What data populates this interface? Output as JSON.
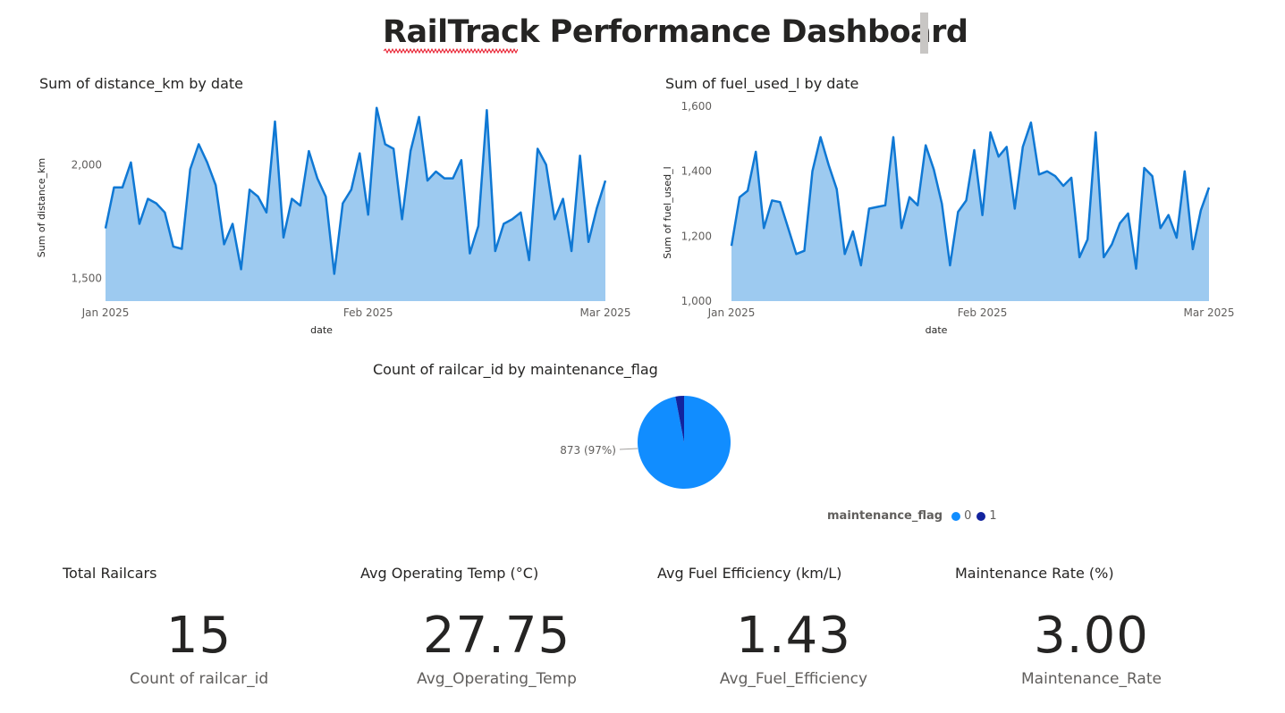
{
  "report": {
    "title": "RailTrack Performance Dashboard"
  },
  "colors": {
    "line": "#0f78d4",
    "area": "#9dcaf0",
    "pie_0": "#118dff",
    "pie_1": "#12239e"
  },
  "chart_data": [
    {
      "type": "area",
      "title": "Sum of distance_km by date",
      "xlabel": "date",
      "ylabel": "Sum of distance_km",
      "x_ticks": [
        "Jan 2025",
        "Feb 2025",
        "Mar 2025"
      ],
      "y_ticks": [
        "1,500",
        "2,000"
      ],
      "y_tick_values": [
        1500,
        2000
      ],
      "ylim": [
        1400,
        2300
      ],
      "xlim": [
        "2025-01-01",
        "2025-03-01"
      ],
      "grid": false,
      "dates": [
        "2025-01-01",
        "2025-01-02",
        "2025-01-03",
        "2025-01-04",
        "2025-01-05",
        "2025-01-06",
        "2025-01-07",
        "2025-01-08",
        "2025-01-09",
        "2025-01-10",
        "2025-01-11",
        "2025-01-12",
        "2025-01-13",
        "2025-01-14",
        "2025-01-15",
        "2025-01-16",
        "2025-01-17",
        "2025-01-18",
        "2025-01-19",
        "2025-01-20",
        "2025-01-21",
        "2025-01-22",
        "2025-01-23",
        "2025-01-24",
        "2025-01-25",
        "2025-01-26",
        "2025-01-27",
        "2025-01-28",
        "2025-01-29",
        "2025-01-30",
        "2025-01-31",
        "2025-02-01",
        "2025-02-02",
        "2025-02-03",
        "2025-02-04",
        "2025-02-05",
        "2025-02-06",
        "2025-02-07",
        "2025-02-08",
        "2025-02-09",
        "2025-02-10",
        "2025-02-11",
        "2025-02-12",
        "2025-02-13",
        "2025-02-14",
        "2025-02-15",
        "2025-02-16",
        "2025-02-17",
        "2025-02-18",
        "2025-02-19",
        "2025-02-20",
        "2025-02-21",
        "2025-02-22",
        "2025-02-23",
        "2025-02-24",
        "2025-02-25",
        "2025-02-26",
        "2025-02-27",
        "2025-02-28",
        "2025-03-01"
      ],
      "values": [
        1720,
        1900,
        1900,
        2010,
        1740,
        1850,
        1830,
        1790,
        1640,
        1630,
        1980,
        2090,
        2010,
        1910,
        1650,
        1740,
        1540,
        1890,
        1860,
        1790,
        2190,
        1680,
        1850,
        1820,
        2060,
        1940,
        1860,
        1520,
        1830,
        1890,
        2050,
        1780,
        2250,
        2090,
        2070,
        1760,
        2060,
        2210,
        1930,
        1970,
        1940,
        1940,
        2020,
        1610,
        1730,
        2240,
        1620,
        1740,
        1760,
        1790,
        1580,
        2070,
        2000,
        1760,
        1850,
        1620,
        2040,
        1660,
        1810,
        1930
      ]
    },
    {
      "type": "area",
      "title": "Sum of fuel_used_l by date",
      "xlabel": "date",
      "ylabel": "Sum of fuel_used_l",
      "x_ticks": [
        "Jan 2025",
        "Feb 2025",
        "Mar 2025"
      ],
      "y_ticks": [
        "1,000",
        "1,200",
        "1,400",
        "1,600"
      ],
      "y_tick_values": [
        1000,
        1200,
        1400,
        1600
      ],
      "ylim": [
        1000,
        1600
      ],
      "xlim": [
        "2025-01-01",
        "2025-03-01"
      ],
      "grid": false,
      "dates": [
        "2025-01-01",
        "2025-01-02",
        "2025-01-03",
        "2025-01-04",
        "2025-01-05",
        "2025-01-06",
        "2025-01-07",
        "2025-01-08",
        "2025-01-09",
        "2025-01-10",
        "2025-01-11",
        "2025-01-12",
        "2025-01-13",
        "2025-01-14",
        "2025-01-15",
        "2025-01-16",
        "2025-01-17",
        "2025-01-18",
        "2025-01-19",
        "2025-01-20",
        "2025-01-21",
        "2025-01-22",
        "2025-01-23",
        "2025-01-24",
        "2025-01-25",
        "2025-01-26",
        "2025-01-27",
        "2025-01-28",
        "2025-01-29",
        "2025-01-30",
        "2025-01-31",
        "2025-02-01",
        "2025-02-02",
        "2025-02-03",
        "2025-02-04",
        "2025-02-05",
        "2025-02-06",
        "2025-02-07",
        "2025-02-08",
        "2025-02-09",
        "2025-02-10",
        "2025-02-11",
        "2025-02-12",
        "2025-02-13",
        "2025-02-14",
        "2025-02-15",
        "2025-02-16",
        "2025-02-17",
        "2025-02-18",
        "2025-02-19",
        "2025-02-20",
        "2025-02-21",
        "2025-02-22",
        "2025-02-23",
        "2025-02-24",
        "2025-02-25",
        "2025-02-26",
        "2025-02-27",
        "2025-02-28",
        "2025-03-01"
      ],
      "values": [
        1170,
        1320,
        1340,
        1460,
        1225,
        1310,
        1305,
        1225,
        1145,
        1155,
        1400,
        1505,
        1420,
        1345,
        1145,
        1215,
        1110,
        1285,
        1290,
        1295,
        1505,
        1225,
        1320,
        1295,
        1480,
        1405,
        1300,
        1110,
        1275,
        1310,
        1465,
        1265,
        1520,
        1445,
        1475,
        1285,
        1475,
        1550,
        1390,
        1400,
        1385,
        1355,
        1380,
        1135,
        1190,
        1520,
        1135,
        1175,
        1240,
        1270,
        1100,
        1410,
        1385,
        1225,
        1265,
        1195,
        1400,
        1160,
        1280,
        1350
      ]
    },
    {
      "type": "pie",
      "title": "Count of railcar_id by maintenance_flag",
      "categories": [
        "0",
        "1"
      ],
      "values": [
        873,
        27
      ],
      "data_labels": [
        "873 (97%)"
      ],
      "legend_title": "maintenance_flag",
      "legend_position": "bottom-right"
    }
  ],
  "cards": [
    {
      "title": "Total Railcars",
      "value": "15",
      "label": "Count of railcar_id"
    },
    {
      "title": "Avg Operating Temp (°C)",
      "value": "27.75",
      "label": "Avg_Operating_Temp"
    },
    {
      "title": "Avg Fuel Efficiency (km/L)",
      "value": "1.43",
      "label": "Avg_Fuel_Efficiency"
    },
    {
      "title": "Maintenance Rate (%)",
      "value": "3.00",
      "label": "Maintenance_Rate"
    }
  ]
}
